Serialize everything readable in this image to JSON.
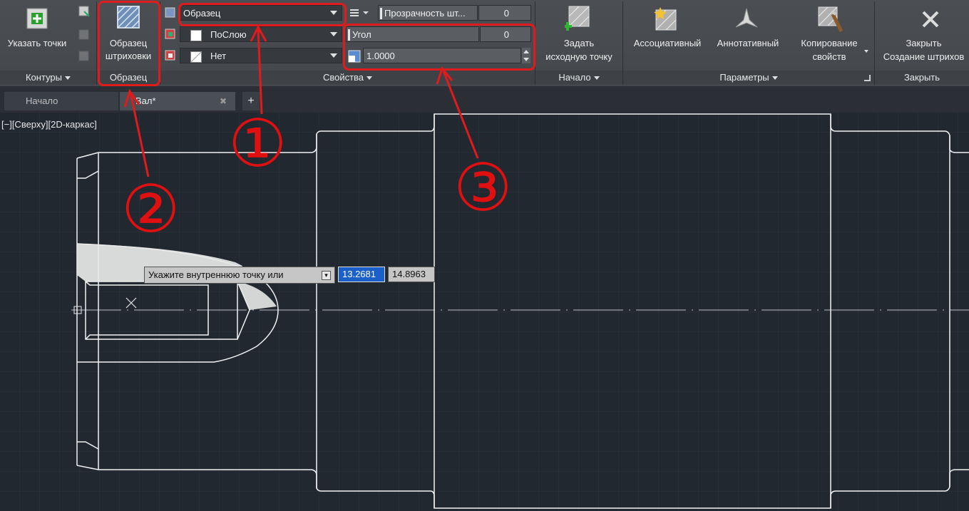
{
  "ribbon": {
    "contours": {
      "pick_points_label": "Указать точки",
      "panel_title": "Контуры"
    },
    "pattern": {
      "button_label_line1": "Образец",
      "button_label_line2": "штриховки",
      "panel_title": "Образец"
    },
    "properties": {
      "hatch_type_value": "Образец",
      "color_value": "ПоСлою",
      "background_value": "Нет",
      "transparency_label": "Прозрачность шт...",
      "transparency_value": "0",
      "angle_label": "Угол",
      "angle_value": "0",
      "scale_value": "1.0000",
      "panel_title": "Свойства"
    },
    "origin": {
      "button_label_line1": "Задать",
      "button_label_line2": "исходную точку",
      "panel_title": "Начало"
    },
    "options": {
      "associative_label": "Ассоциативный",
      "annotative_label": "Аннотативный",
      "match_label_line1": "Копирование",
      "match_label_line2": "свойств",
      "panel_title": "Параметры"
    },
    "close": {
      "button_label_line1": "Закрыть",
      "button_label_line2": "Создание штрихов",
      "panel_title": "Закрыть"
    }
  },
  "tabs": [
    {
      "label": "Начало"
    },
    {
      "label": "Вал*"
    }
  ],
  "viewport": {
    "view_label": "[−][Сверху][2D-каркас]",
    "prompt_text": "Укажите внутреннюю точку или",
    "coord_x": "13.2681",
    "coord_y": "14.8963"
  },
  "annotations": {
    "one": "①",
    "two": "②",
    "three": "③",
    "color": "#e01010"
  }
}
